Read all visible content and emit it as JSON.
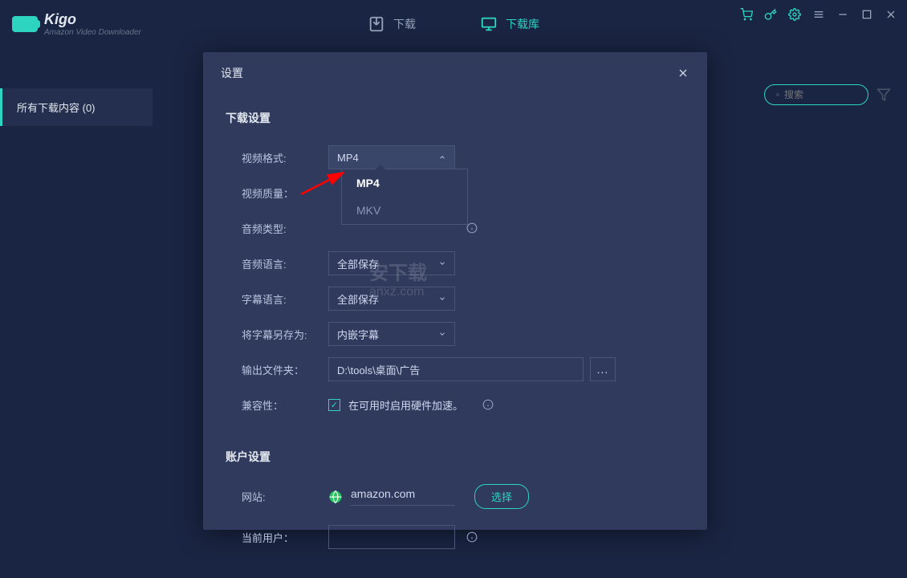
{
  "app": {
    "name": "Kigo",
    "subtitle": "Amazon Video Downloader"
  },
  "tabs": {
    "download": "下载",
    "library": "下载库"
  },
  "sidebar": {
    "all_downloads": "所有下载内容 (0)"
  },
  "search": {
    "placeholder": "搜索"
  },
  "modal": {
    "title": "设置",
    "section_download": "下载设置",
    "section_account": "账户设置",
    "video_format_label": "视频格式:",
    "video_format_value": "MP4",
    "video_quality_label": "视频质量：",
    "audio_type_label": "音频类型:",
    "audio_lang_label": "音频语言:",
    "audio_lang_value": "全部保存",
    "subtitle_lang_label": "字幕语言:",
    "subtitle_lang_value": "全部保存",
    "subtitle_save_label": "将字幕另存为:",
    "subtitle_save_value": "内嵌字幕",
    "output_folder_label": "输出文件夹：",
    "output_folder_value": "D:\\tools\\桌面\\广告",
    "browse_btn": "...",
    "compat_label": "兼容性：",
    "compat_checkbox": "在可用时启用硬件加速。",
    "website_label": "网站:",
    "website_value": "amazon.com",
    "choose_btn": "选择",
    "current_user_label": "当前用户：",
    "dropdown": {
      "opt1": "MP4",
      "opt2": "MKV"
    }
  },
  "watermark": {
    "main": "安下载",
    "sub": "anxz.com"
  }
}
